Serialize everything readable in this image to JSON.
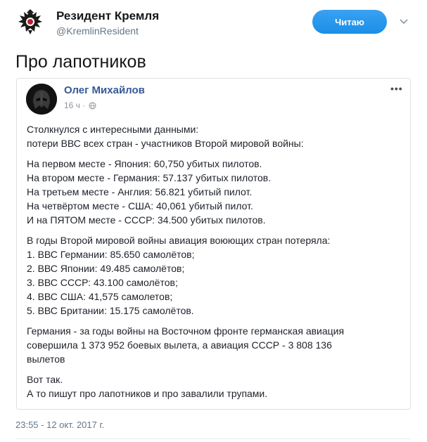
{
  "author": {
    "name": "Резидент Кремля",
    "handle": "@KremlinResident",
    "avatar_icon": "eagle-emblem-icon"
  },
  "follow_button": {
    "label": "Читаю"
  },
  "menu_icon": "chevron-down-icon",
  "tweet": {
    "text": "Про лапотников"
  },
  "embedded_post": {
    "author_name": "Олег Михайлов",
    "time": "16 ч",
    "privacy_icon": "globe-icon",
    "menu": "•••",
    "paragraphs": [
      {
        "lines": [
          "Столкнулся с интересными данными:",
          "потери ВВС всех стран - участников Второй мировой войны:"
        ]
      },
      {
        "lines": [
          "На первом месте - Япония: 60,750 убитых пилотов.",
          "На втором месте - Германия: 57.137 убитых пилотов.",
          "На третьем месте - Англия: 56.821 убитый пилот.",
          "На четвёртом месте - США: 40,061 убитый пилот.",
          "И на ПЯТОМ месте - СССР: 34.500 убитых пилотов."
        ]
      },
      {
        "lines": [
          "В годы Второй мировой войны авиация воюющих стран потеряла:",
          "1. ВВС Германии: 85.650 самолётов;",
          "2. ВВС Японии: 49.485 самолётов;",
          "3. ВВС СССР: 43.100 самолётов;",
          "4. ВВС США: 41,575 самолетов;",
          "5. ВВС Британии: 15.175 самолётов."
        ]
      },
      {
        "lines": [
          "Германия - за годы войны на Восточном фронте германская авиация",
          "совершила 1 373 952 боевых вылета, а авиация СССР - 3 808 136",
          "вылетов"
        ]
      },
      {
        "lines": [
          "Вот так.",
          "А то пишут про лапотников и про завалили трупами."
        ]
      }
    ]
  },
  "timestamp": "23:55 - 12 окт. 2017 г.",
  "colors": {
    "follow_button": "#1da1f2",
    "fb_name": "#365899",
    "muted": "#657786"
  }
}
